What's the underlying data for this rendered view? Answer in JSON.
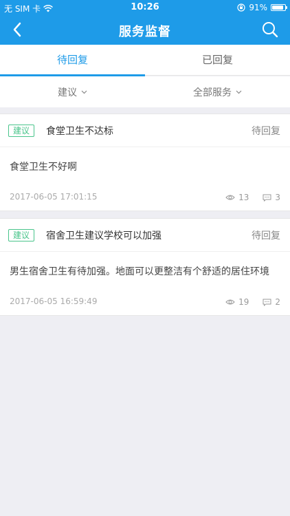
{
  "status": {
    "carrier": "无 SIM 卡",
    "time": "10:26",
    "battery": "91%",
    "battery_level": 0.91
  },
  "nav": {
    "title": "服务监督",
    "back_icon": "chevron-left-icon",
    "search_icon": "search-icon"
  },
  "tabs": [
    {
      "label": "待回复"
    },
    {
      "label": "已回复"
    }
  ],
  "filters": [
    {
      "label": "建议"
    },
    {
      "label": "全部服务"
    }
  ],
  "colors": {
    "accent": "#1e9be8",
    "tag": "#48c48a"
  },
  "posts": [
    {
      "tag": "建议",
      "title": "食堂卫生不达标",
      "state": "待回复",
      "body": "食堂卫生不好啊",
      "time": "2017-06-05 17:01:15",
      "views": "13",
      "comments": "3"
    },
    {
      "tag": "建议",
      "title": "宿舍卫生建议学校可以加强",
      "state": "待回复",
      "body": "男生宿舍卫生有待加强。地面可以更整洁有个舒适的居住环境",
      "time": "2017-06-05 16:59:49",
      "views": "19",
      "comments": "2"
    }
  ]
}
